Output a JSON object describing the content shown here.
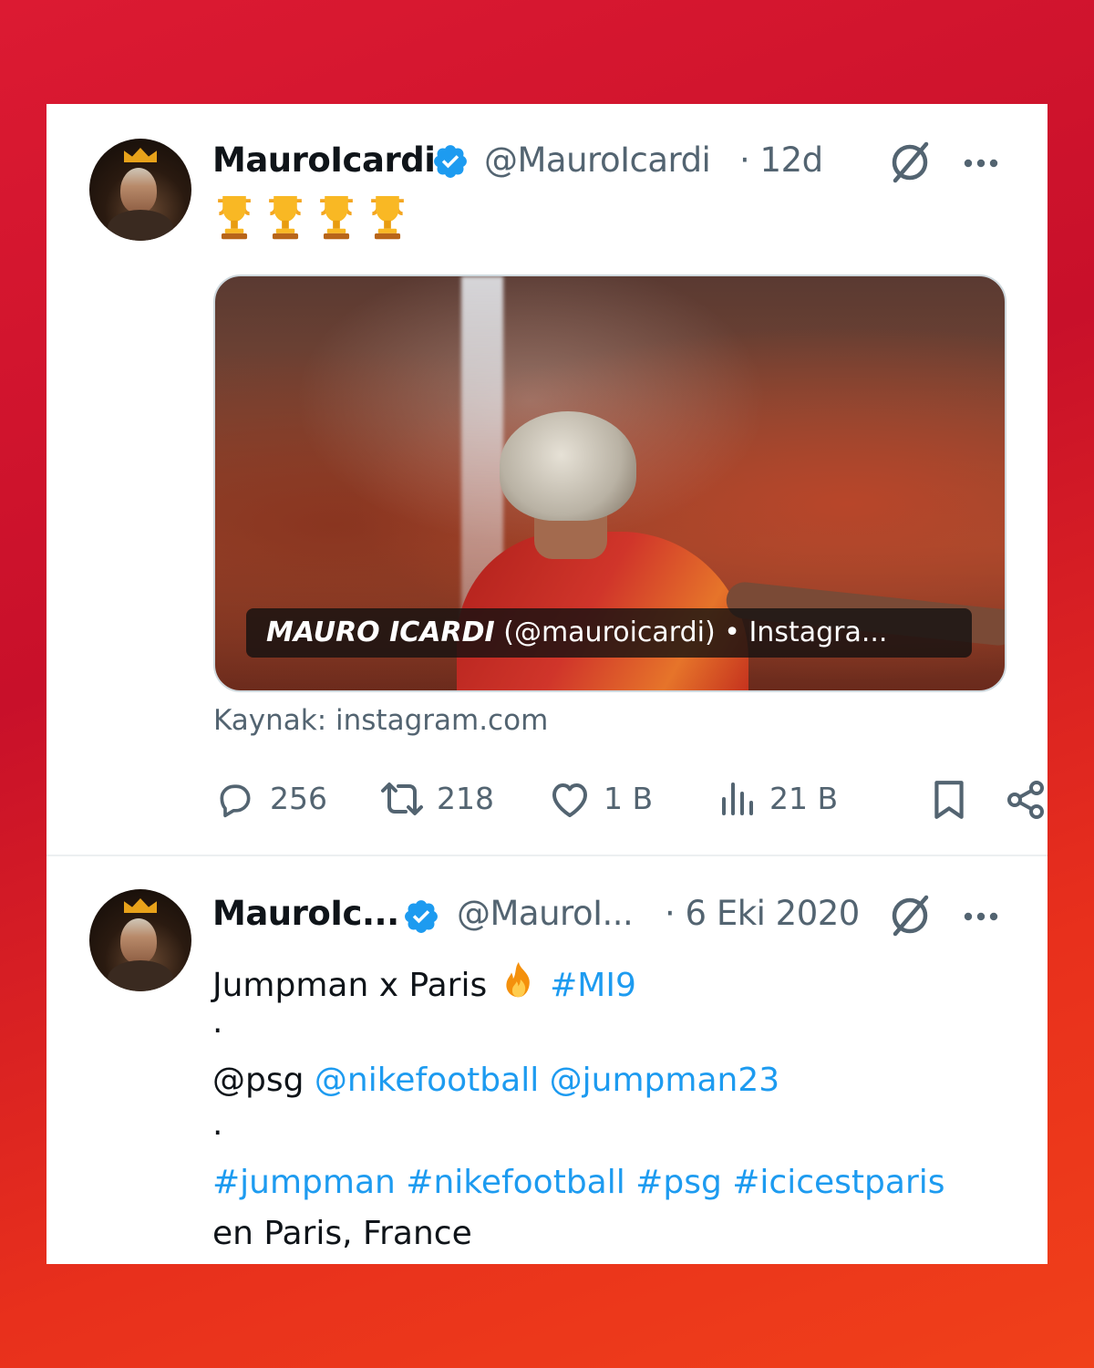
{
  "tweet1": {
    "display_name": "MauroIcardi",
    "handle": "@MauroIcardi",
    "time": "· 12d",
    "trophy_count": 4,
    "media_caption_bold": "MAURO ICARDI",
    "media_caption_rest": " (@mauroicardi) • Instagra...",
    "source": "Kaynak: instagram.com",
    "replies": "256",
    "retweets": "218",
    "likes": "1 B",
    "views": "21 B"
  },
  "tweet2": {
    "display_name": "MauroIc...",
    "handle": "@MauroI...",
    "time": "· 6 Eki 2020",
    "line1_text": "Jumpman x Paris",
    "line1_hashtag": "#MI9",
    "dot1": "·",
    "mention_plain": "@psg",
    "mention_links": "@nikefootball @jumpman23",
    "dot2": "·",
    "hashtags": "#jumpman #nikefootball #psg #icicestparis",
    "location": "en Paris, France"
  },
  "colors": {
    "link": "#1d9bf0",
    "text": "#0f1419",
    "muted": "#536471",
    "verified": "#1d9bf0",
    "background": "#d0162c"
  },
  "icons": [
    "verified-badge-icon",
    "grok-icon",
    "more-icon",
    "trophy-icon",
    "reply-icon",
    "retweet-icon",
    "like-icon",
    "views-icon",
    "bookmark-icon",
    "share-icon",
    "fire-icon"
  ]
}
